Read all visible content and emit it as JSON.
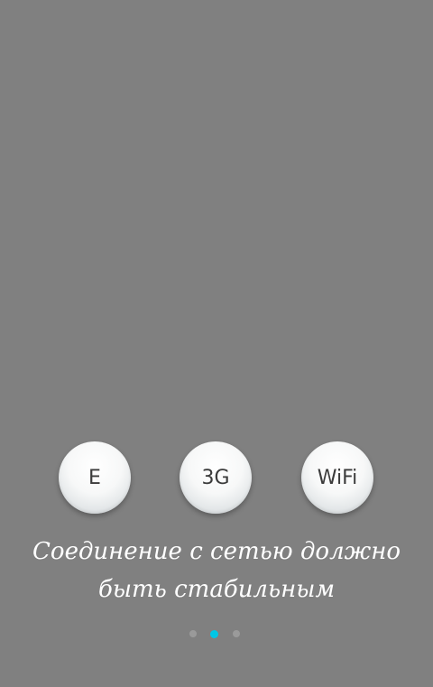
{
  "network_options": [
    {
      "label": "E"
    },
    {
      "label": "3G"
    },
    {
      "label": "WiFi"
    }
  ],
  "caption": {
    "line1": "Соединение с сетью должно",
    "line2": "быть стабильным"
  },
  "pager": {
    "total": 3,
    "active_index": 1,
    "active_color": "#00c7e6",
    "inactive_color": "#9a9a9a"
  },
  "colors": {
    "background": "#808080"
  }
}
